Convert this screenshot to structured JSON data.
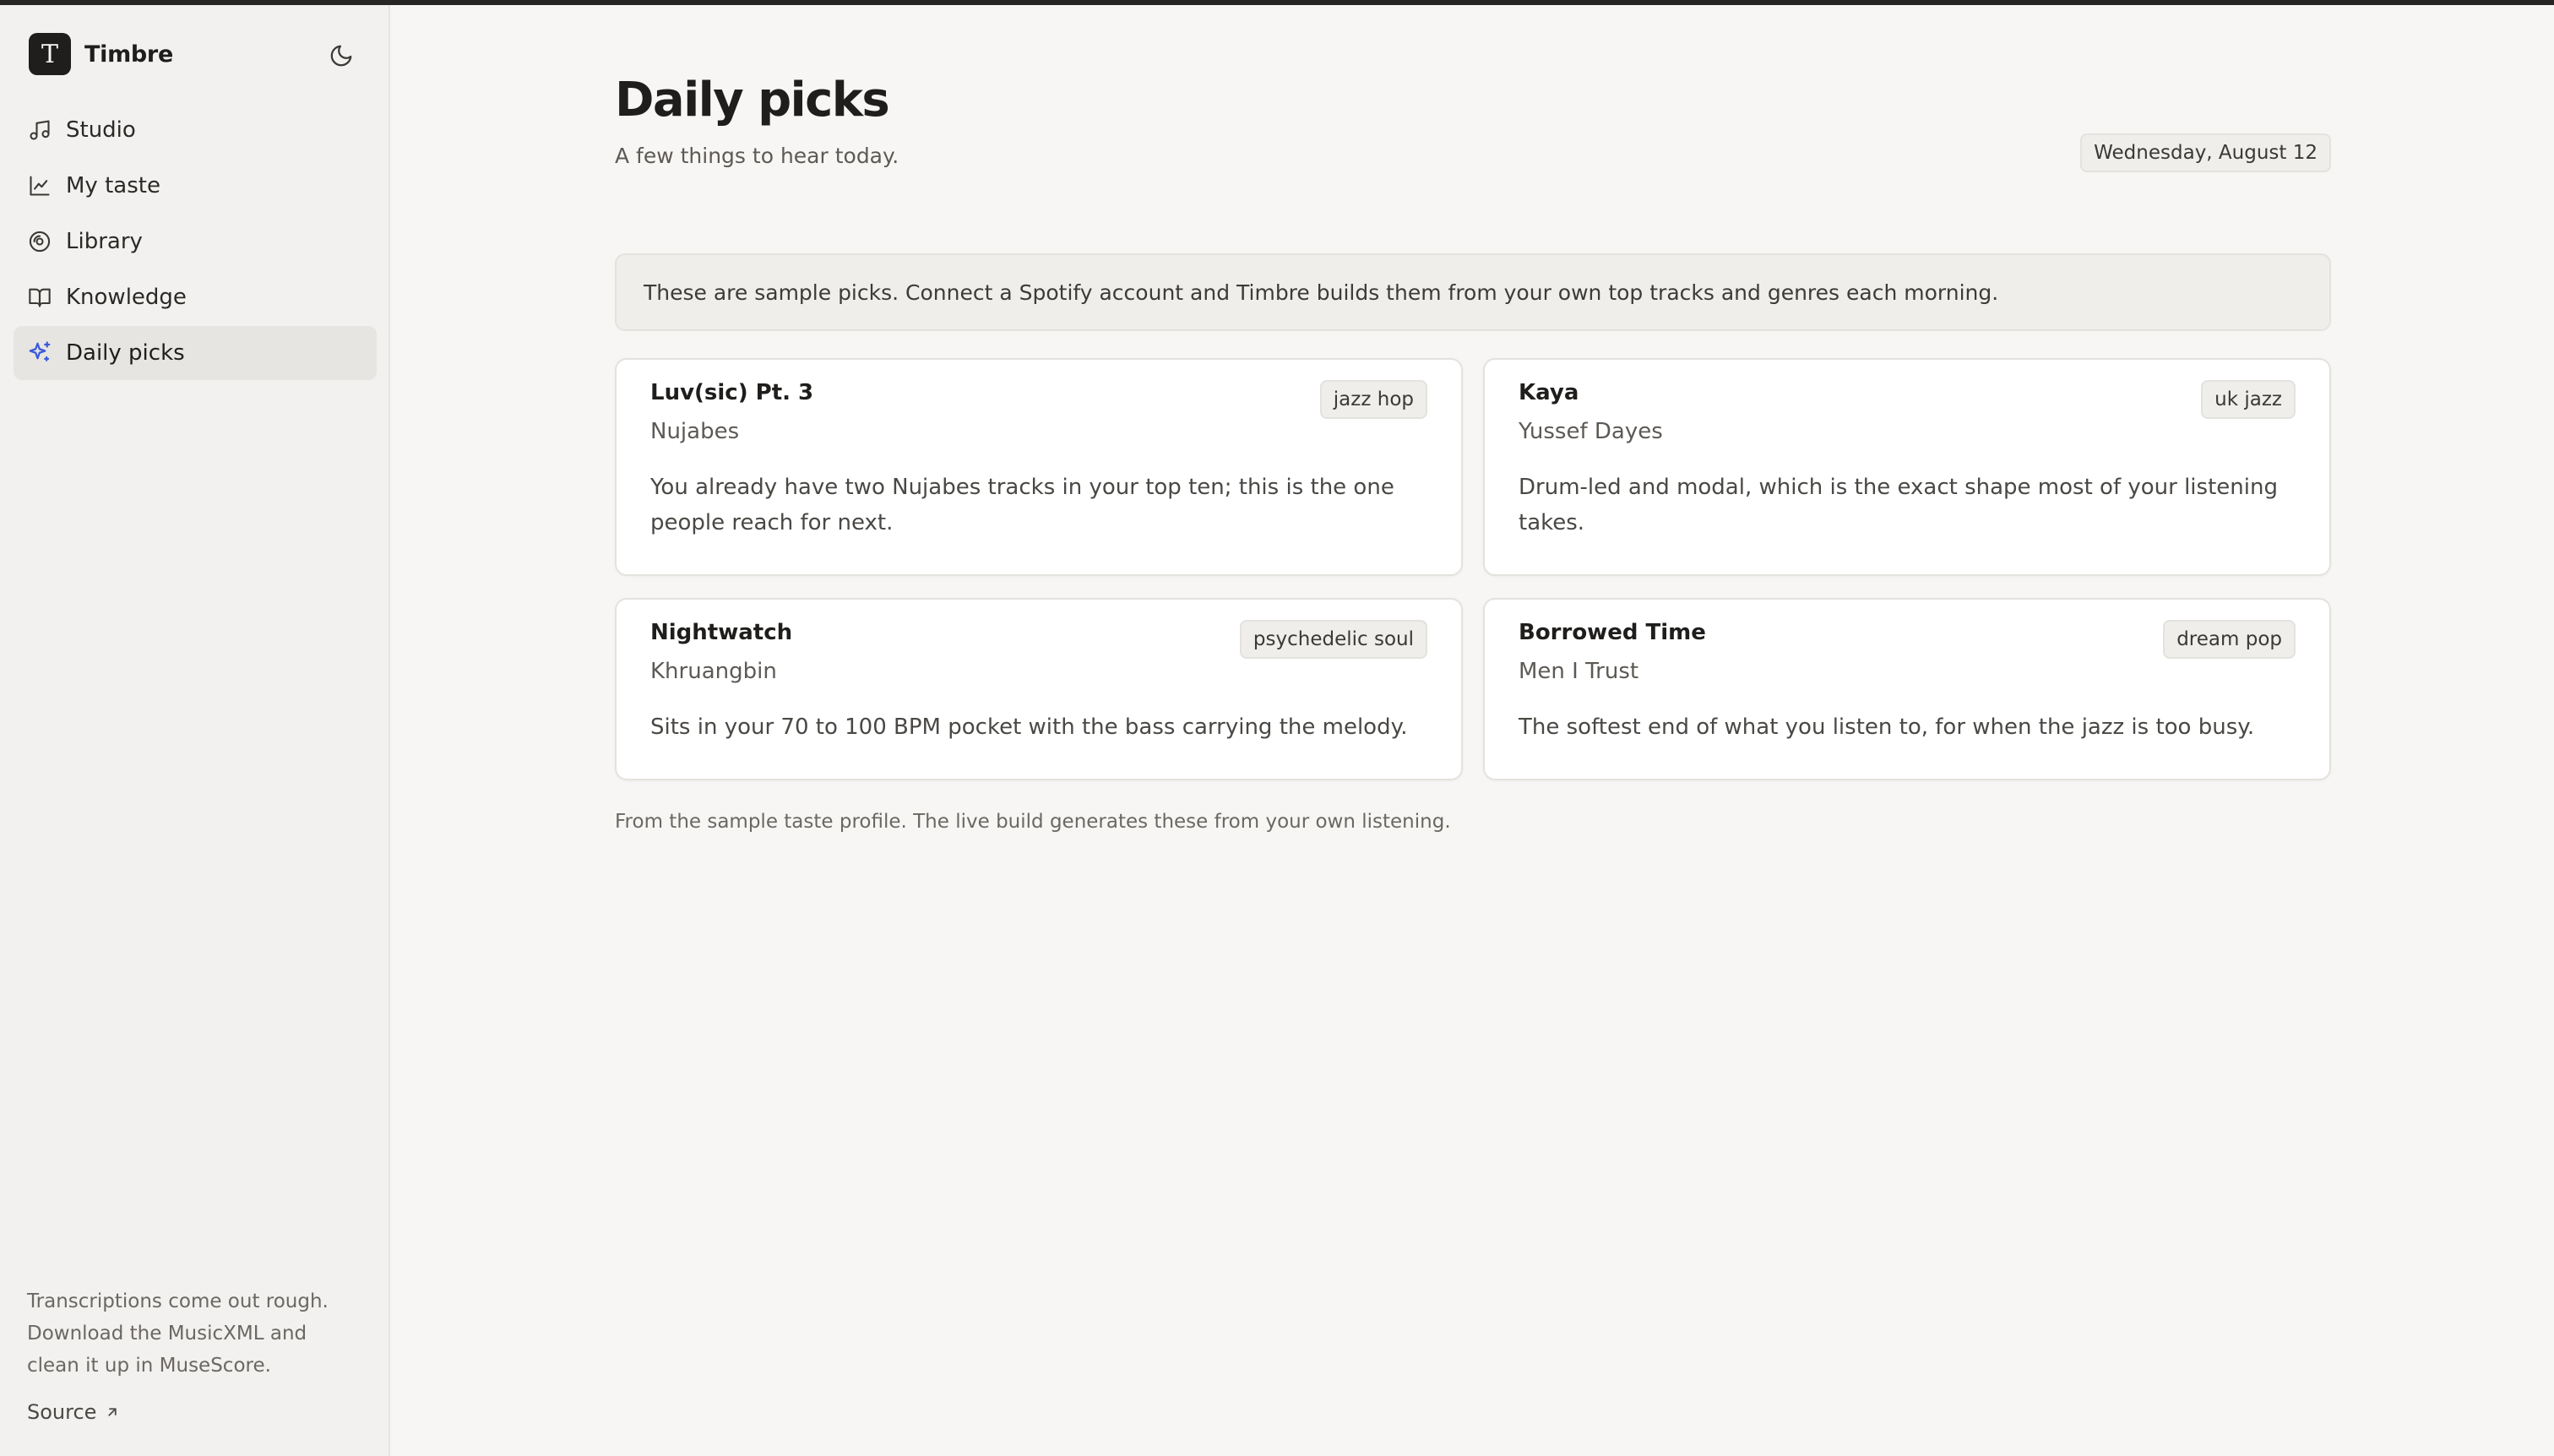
{
  "app": {
    "name": "Timbre",
    "logo_letter": "T"
  },
  "sidebar": {
    "items": [
      {
        "label": "Studio",
        "icon": "music-note-icon",
        "active": false
      },
      {
        "label": "My taste",
        "icon": "line-chart-icon",
        "active": false
      },
      {
        "label": "Library",
        "icon": "vinyl-disc-icon",
        "active": false
      },
      {
        "label": "Knowledge",
        "icon": "open-book-icon",
        "active": false
      },
      {
        "label": "Daily picks",
        "icon": "sparkle-icon",
        "active": true
      }
    ],
    "note": "Transcriptions come out rough. Download the MusicXML and clean it up in MuseScore.",
    "source_label": "Source"
  },
  "page": {
    "title": "Daily picks",
    "subtitle": "A few things to hear today.",
    "date": "Wednesday, August 12",
    "notice": "These are sample picks. Connect a Spotify account and Timbre builds them from your own top tracks and genres each morning.",
    "footer": "From the sample taste profile. The live build generates these from your own listening."
  },
  "picks": [
    {
      "title": "Luv(sic) Pt. 3",
      "artist": "Nujabes",
      "genre": "jazz hop",
      "reason": "You already have two Nujabes tracks in your top ten; this is the one people reach for next."
    },
    {
      "title": "Kaya",
      "artist": "Yussef Dayes",
      "genre": "uk jazz",
      "reason": "Drum-led and modal, which is the exact shape most of your listening takes."
    },
    {
      "title": "Nightwatch",
      "artist": "Khruangbin",
      "genre": "psychedelic soul",
      "reason": "Sits in your 70 to 100 BPM pocket with the bass carrying the melody."
    },
    {
      "title": "Borrowed Time",
      "artist": "Men I Trust",
      "genre": "dream pop",
      "reason": "The softest end of what you listen to, for when the jazz is too busy."
    }
  ],
  "colors": {
    "accent": "#3b5bdb",
    "background": "#f7f6f4",
    "sidebar": "#f2f1ef"
  }
}
